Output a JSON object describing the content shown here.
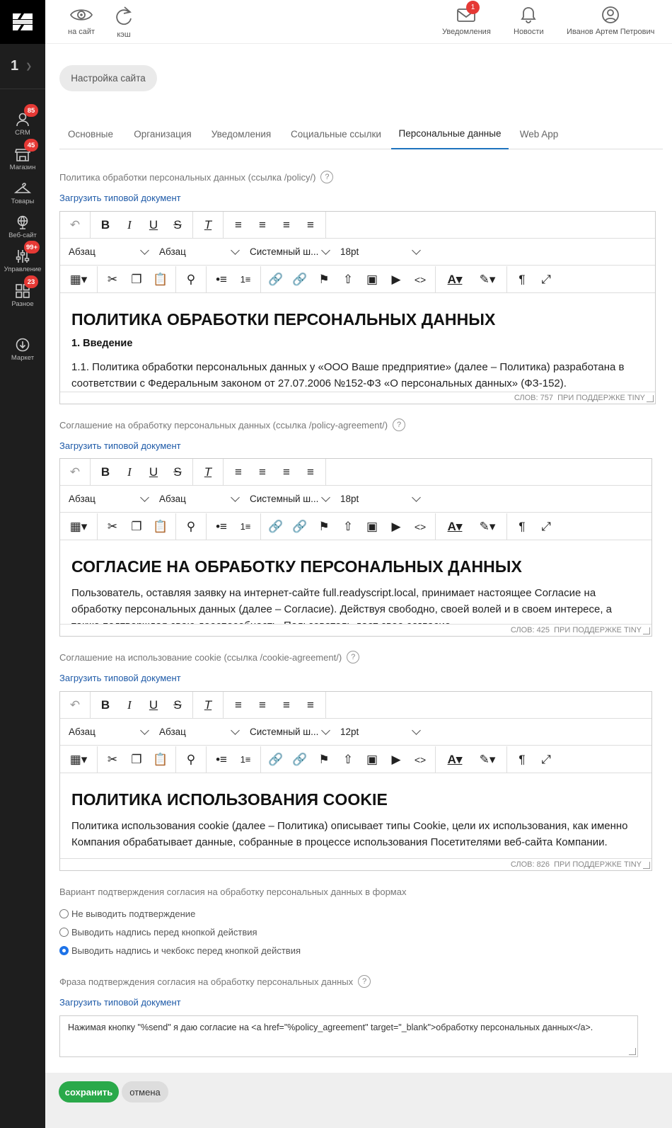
{
  "sidebar": {
    "site_number": "1",
    "items": [
      {
        "label": "CRM",
        "badge": "85",
        "icon": "crm-icon"
      },
      {
        "label": "Магазин",
        "badge": "45",
        "icon": "shop-icon"
      },
      {
        "label": "Товары",
        "badge": "",
        "icon": "hanger-icon"
      },
      {
        "label": "Веб-сайт",
        "badge": "",
        "icon": "globe-icon"
      },
      {
        "label": "Управление",
        "badge": "99+",
        "icon": "sliders-icon"
      },
      {
        "label": "Разное",
        "badge": "23",
        "icon": "grid-icon"
      },
      {
        "label": "Маркет",
        "badge": "",
        "icon": "download-icon"
      }
    ]
  },
  "topbar": {
    "to_site": "на сайт",
    "cache": "кэш",
    "notifications": "Уведомления",
    "notifications_badge": "1",
    "news": "Новости",
    "user": "Иванов Артем Петрович"
  },
  "page": {
    "title": "Настройка сайта"
  },
  "tabs": [
    "Основные",
    "Организация",
    "Уведомления",
    "Социальные ссылки",
    "Персональные данные",
    "Web App"
  ],
  "editor_common": {
    "load_link": "Загрузить типовой документ",
    "block_format": "Абзац",
    "style_format": "Абзац",
    "font_family": "Системный ш...",
    "powered": "ПРИ ПОДДЕРЖКЕ TINY"
  },
  "policy": {
    "label": "Политика обработки персональных данных (ссылка /policy/)",
    "font_size": "18pt",
    "heading": "ПОЛИТИКА ОБРАБОТКИ ПЕРСОНАЛЬНЫХ ДАННЫХ",
    "subheading": "1. Введение",
    "text": "1.1. Политика обработки персональных данных у «ООО Ваше предприятие» (далее – Политика) разработана в соответствии с Федеральным законом от 27.07.2006 №152-ФЗ «О персональных данных» (ФЗ-152).",
    "words": "СЛОВ: 757"
  },
  "agreement": {
    "label": "Соглашение на обработку персональных данных (ссылка /policy-agreement/)",
    "font_size": "18pt",
    "heading": "СОГЛАСИЕ НА ОБРАБОТКУ ПЕРСОНАЛЬНЫХ ДАННЫХ",
    "text": "Пользователь, оставляя заявку на интернет-сайте full.readyscript.local, принимает настоящее Согласие на обработку персональных данных (далее – Согласие). Действуя свободно, своей волей и в своем интересе, а также подтверждая свою дееспособность, Пользователь дает свое согласие.",
    "words": "СЛОВ: 425"
  },
  "cookie": {
    "label": "Соглашение на использование cookie (ссылка /cookie-agreement/)",
    "font_size": "12pt",
    "heading": "ПОЛИТИКА ИСПОЛЬЗОВАНИЯ COOKIE",
    "text": "Политика использования cookie (далее – Политика) описывает типы Cookie, цели их использования, как именно Компания обрабатывает данные, собранные в процессе использования Посетителями веб-сайта Компании.",
    "words": "СЛОВ: 826"
  },
  "consent": {
    "label": "Вариант подтверждения согласия на обработку персональных данных в формах",
    "options": [
      {
        "label": "Не выводить подтверждение",
        "checked": false
      },
      {
        "label": "Выводить надпись перед кнопкой действия",
        "checked": false
      },
      {
        "label": "Выводить надпись и чекбокс перед кнопкой действия",
        "checked": true
      }
    ]
  },
  "phrase": {
    "label": "Фраза подтверждения согласия на обработку персональных данных",
    "value": "Нажимая кнопку \"%send\" я даю согласие на <a href=\"%policy_agreement\" target=\"_blank\">обработку персональных данных</a>."
  },
  "actions": {
    "save": "сохранить",
    "cancel": "отмена"
  }
}
